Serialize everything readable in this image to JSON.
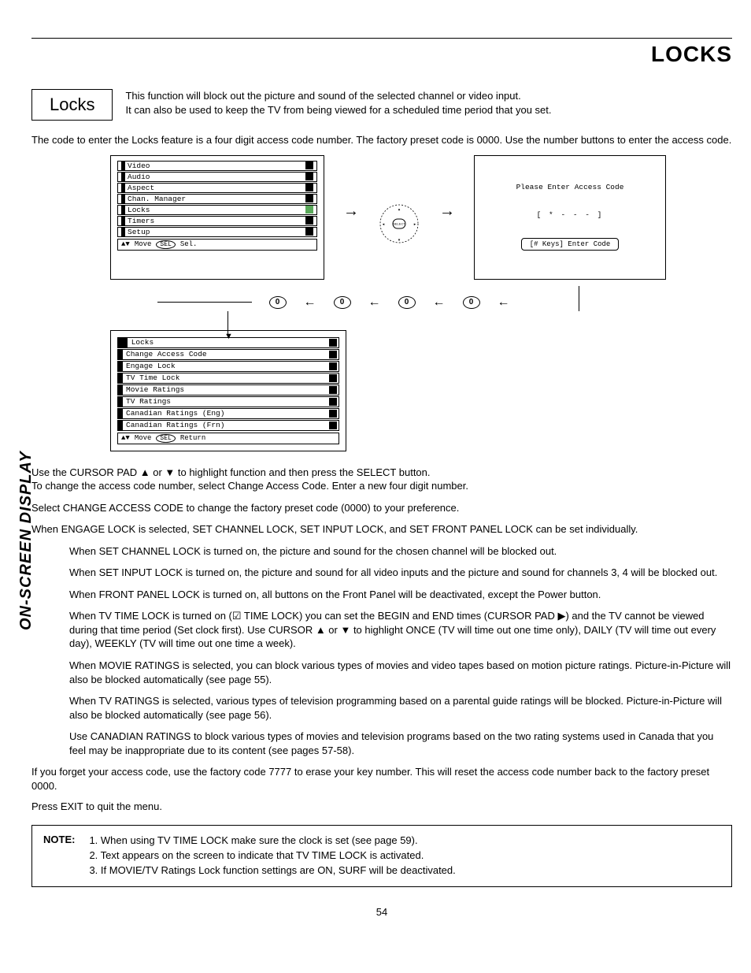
{
  "header": {
    "title": "LOCKS"
  },
  "section": {
    "title": "Locks"
  },
  "intro": {
    "line1": "This function will block out the picture and sound of the selected channel or video input.",
    "line2": "It can also be used to keep the TV from being viewed for a scheduled time period that you set."
  },
  "preamble": "The code to enter the Locks feature is a four digit access code number.  The factory preset code is 0000. Use the number buttons to enter the access code.",
  "osd_main_menu": {
    "items": [
      {
        "label": "Video"
      },
      {
        "label": "Audio"
      },
      {
        "label": "Aspect"
      },
      {
        "label": "Chan. Manager"
      },
      {
        "label": "Locks",
        "selected": true
      },
      {
        "label": "Timers"
      },
      {
        "label": "Setup"
      }
    ],
    "footer_move": "Move",
    "footer_sel_oval": "SEL",
    "footer_sel": "Sel."
  },
  "remote": {
    "button_label": "SELECT"
  },
  "access_panel": {
    "title": "Please Enter Access Code",
    "code_display": "[ * - - - ]",
    "hint": "[# Keys] Enter Code"
  },
  "zero_buttons": [
    "0",
    "0",
    "0",
    "0"
  ],
  "locks_submenu": {
    "heading": "Locks",
    "items": [
      "Change Access Code",
      "Engage Lock",
      "TV Time Lock",
      "Movie Ratings",
      "TV Ratings",
      "Canadian Ratings (Eng)",
      "Canadian Ratings (Frn)"
    ],
    "footer_move": "Move",
    "footer_sel_oval": "SEL",
    "footer_return": "Return"
  },
  "body": {
    "p1": "Use the CURSOR PAD ▲ or ▼ to highlight function and then press the SELECT button.",
    "p1b": "To change the access code number, select Change Access Code.  Enter a new four digit number.",
    "p2": "Select CHANGE ACCESS CODE to change the factory preset code (0000) to your preference.",
    "p3": "When ENGAGE LOCK is selected, SET CHANNEL LOCK, SET INPUT LOCK, and SET FRONT PANEL LOCK can be set individually.",
    "p4": "When SET CHANNEL LOCK is turned on, the picture and sound for the chosen channel will be blocked out.",
    "p5": "When SET INPUT LOCK is turned on, the picture and sound for all video inputs and the picture and sound for channels 3, 4 will be blocked out.",
    "p6": "When FRONT PANEL LOCK is turned on, all buttons on the Front Panel will be deactivated, except the Power button.",
    "p7": "When TV TIME LOCK is turned on (☑ TIME LOCK) you can set the BEGIN and END times (CURSOR PAD ▶) and the TV cannot be viewed during that time period (Set clock first). Use CURSOR ▲ or ▼ to highlight ONCE (TV will time out one time only), DAILY (TV will time out every day), WEEKLY (TV will time out one time a week).",
    "p8": "When MOVIE RATINGS is selected, you can block various types of movies and video tapes based on motion picture ratings.  Picture-in-Picture will also be blocked automatically (see page 55).",
    "p9": "When TV RATINGS is selected, various types of television programming based on a parental guide ratings will be blocked. Picture-in-Picture will also be blocked automatically (see page 56).",
    "p10": "Use CANADIAN RATINGS to block various types of movies and television programs based on the two rating systems used in Canada that you feel may be inappropriate due to its content (see pages 57-58).",
    "p11": "If you forget your access code, use the factory code 7777 to erase your key number. This will reset the access code number back to the factory preset 0000.",
    "p12": "Press EXIT to quit the menu."
  },
  "note": {
    "label": "NOTE:",
    "n1": "1. When using TV TIME LOCK make sure the clock is set (see page 59).",
    "n2": "2. Text appears on the screen to indicate that TV TIME LOCK is activated.",
    "n3": "3. If MOVIE/TV Ratings Lock function settings are ON, SURF will be deactivated."
  },
  "side_label": "ON-SCREEN DISPLAY",
  "page_number": "54"
}
